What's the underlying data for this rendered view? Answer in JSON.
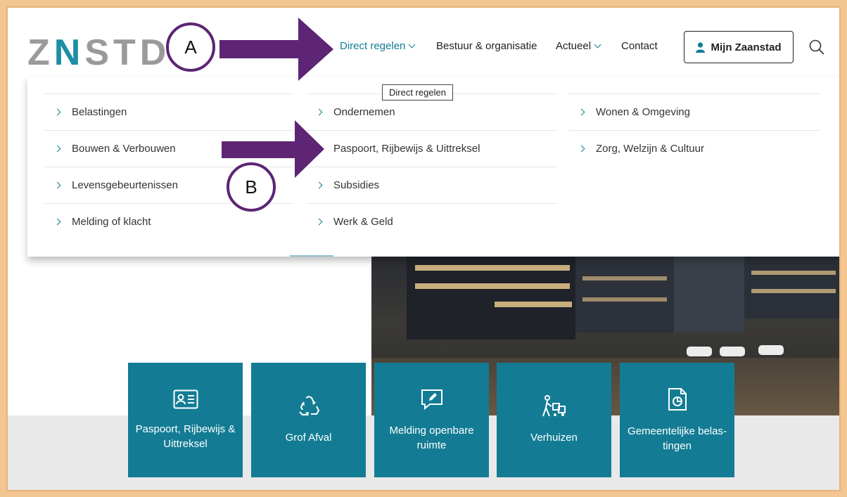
{
  "header": {
    "logo": {
      "pre": "Z",
      "n": "N",
      "post": "STD"
    },
    "nav": [
      {
        "label": "Direct regelen"
      },
      {
        "label": "Bestuur & organisatie"
      },
      {
        "label": "Actueel"
      },
      {
        "label": "Contact"
      }
    ],
    "account_label": "Mijn Zaanstad"
  },
  "tooltip": "Direct regelen",
  "dropdown": {
    "col1": [
      "Belastingen",
      "Bouwen & Verbouwen",
      "Levensgebeurtenissen",
      "Melding of klacht"
    ],
    "col2": [
      "Ondernemen",
      "Paspoort, Rijbewijs & Uittreksel",
      "Subsidies",
      "Werk & Geld"
    ],
    "col3": [
      "Wonen & Omgeving",
      "Zorg, Welzijn & Cultuur"
    ]
  },
  "annotations": {
    "a": "A",
    "b": "B"
  },
  "tiles": [
    {
      "line1": "Paspoort, Rijbewijs &",
      "line2": "Uittreksel",
      "icon": "id-card-icon"
    },
    {
      "line1": "Grof Afval",
      "line2": "",
      "icon": "recycle-icon"
    },
    {
      "line1": "Melding openbare",
      "line2": "ruimte",
      "icon": "report-speech-icon"
    },
    {
      "line1": "Verhuizen",
      "line2": "",
      "icon": "moving-person-icon"
    },
    {
      "line1": "Gemeentelijke belas-",
      "line2": "tingen",
      "icon": "tax-document-icon"
    }
  ],
  "colors": {
    "brand_teal": "#137c94",
    "annotation_purple": "#5d2574",
    "frame": "#f3c591"
  }
}
